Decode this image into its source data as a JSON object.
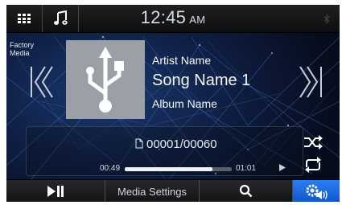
{
  "status": {
    "time": "12:45",
    "ampm": "AM"
  },
  "source": {
    "line1": "Factory",
    "line2": "Media"
  },
  "track": {
    "artist": "Artist Name",
    "song": "Song Name 1",
    "album": "Album Name",
    "counter": "00001/00060",
    "elapsed": "00:49",
    "remaining": "01:01",
    "progress_percent": 82
  },
  "bottom": {
    "media_settings_label": "Media Settings"
  },
  "icons": {
    "menu": "menu-grid-icon",
    "music_source": "music-note-icon",
    "bluetooth": "bluetooth-icon",
    "prev": "skip-previous-icon",
    "next": "skip-next-icon",
    "usb": "usb-icon",
    "file": "file-icon",
    "shuffle": "shuffle-icon",
    "repeat": "repeat-icon",
    "play_pause": "play-pause-icon",
    "search": "search-icon",
    "audio_settings": "audio-settings-icon"
  },
  "colors": {
    "accent": "#1e6be6",
    "background": "#0b1228"
  }
}
